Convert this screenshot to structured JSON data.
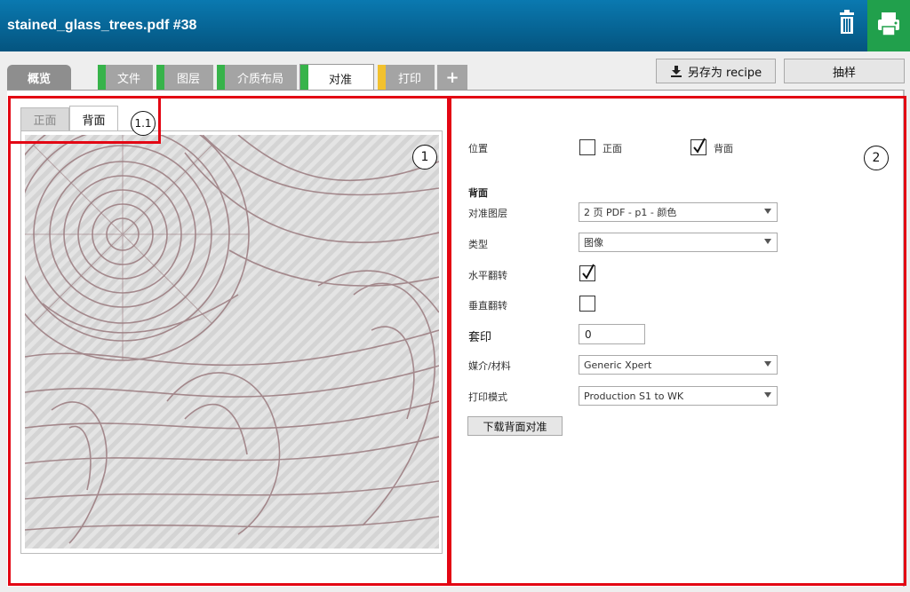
{
  "header": {
    "title": "stained_glass_trees.pdf #38"
  },
  "tabs": [
    {
      "label": "概览",
      "stripe": ""
    },
    {
      "label": "文件",
      "stripe": "#37b34a"
    },
    {
      "label": "图层",
      "stripe": "#37b34a"
    },
    {
      "label": "介质布局",
      "stripe": "#37b34a"
    },
    {
      "label": "对准",
      "stripe": "#37b34a",
      "active": true
    },
    {
      "label": "打印",
      "stripe": "#f2c12e"
    },
    {
      "label": "+",
      "stripe": ""
    }
  ],
  "toolbar": {
    "save_recipe": "另存为 recipe",
    "sample": "抽样"
  },
  "side_tabs": {
    "front": "正面",
    "back": "背面"
  },
  "callouts": {
    "c1": "1",
    "c11": "1.1",
    "c2": "2"
  },
  "form": {
    "position_label": "位置",
    "position_front": "正面",
    "position_back": "背面",
    "section_title": "背面",
    "layer_label": "对准图层",
    "layer_value": "2 页 PDF - p1 - 颜色",
    "type_label": "类型",
    "type_value": "图像",
    "hflip_label": "水平翻转",
    "vflip_label": "垂直翻转",
    "overprint_label": "套印",
    "overprint_value": "0",
    "media_label": "媒介/材料",
    "media_value": "Generic Xpert",
    "mode_label": "打印模式",
    "mode_value": "Production S1 to WK",
    "download_button": "下载背面对准"
  },
  "state": {
    "front_checked": false,
    "back_checked": true,
    "hflip": true,
    "vflip": false
  },
  "colors": {
    "header_top": "#0a79b0",
    "header_bottom": "#04547f",
    "print_green": "#21a04c",
    "highlight_red": "#e30613",
    "stripe_green": "#37b34a",
    "stripe_yellow": "#f2c12e"
  }
}
